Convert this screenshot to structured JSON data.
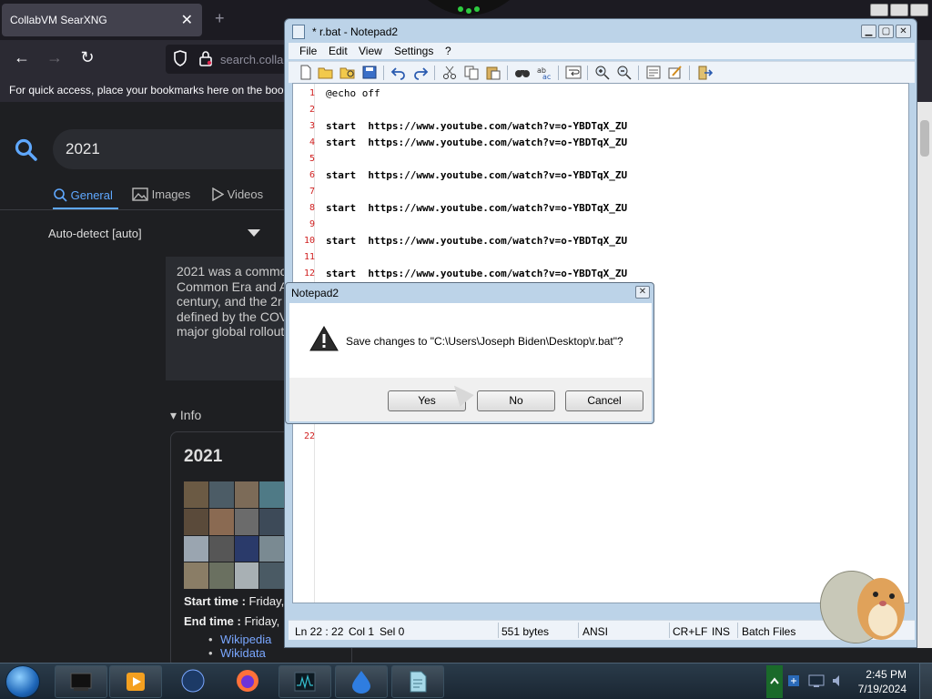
{
  "browser": {
    "tab_title": "CollabVM SearXNG",
    "tab_close": "✕",
    "new_tab": "+",
    "url_text": "search.colla",
    "bookmarks_hint": "For quick access, place your bookmarks here on the book",
    "search_query": "2021",
    "categories": [
      {
        "label": "General",
        "icon": "search-icon",
        "active": true
      },
      {
        "label": "Images",
        "icon": "image-icon",
        "active": false
      },
      {
        "label": "Videos",
        "icon": "play-icon",
        "active": false
      }
    ],
    "language_select": "Auto-detect [auto]",
    "answer_lines": [
      "2021 was a commo",
      "Common Era and A",
      "century, and the 2r",
      "defined by the COV",
      "major global rollout"
    ],
    "info_header": "▾ Info",
    "infobox": {
      "title": "2021",
      "start_label": "Start time :",
      "start_value": "Friday,",
      "end_label": "End time :",
      "end_value": "Friday,",
      "links": [
        "Wikipedia",
        "Wikidata"
      ]
    }
  },
  "notepad": {
    "title": "* r.bat - Notepad2",
    "menu": [
      "File",
      "Edit",
      "View",
      "Settings",
      "?"
    ],
    "lines": [
      {
        "num": "1",
        "text": "@echo off",
        "cmd": ""
      },
      {
        "num": "2",
        "text": "",
        "cmd": ""
      },
      {
        "num": "3",
        "cmd": "start",
        "text": "  https://www.youtube.com/watch?v=o-YBDTqX_ZU"
      },
      {
        "num": "4",
        "cmd": "start",
        "text": "  https://www.youtube.com/watch?v=o-YBDTqX_ZU"
      },
      {
        "num": "5",
        "text": "",
        "cmd": ""
      },
      {
        "num": "6",
        "cmd": "start",
        "text": "  https://www.youtube.com/watch?v=o-YBDTqX_ZU"
      },
      {
        "num": "7",
        "text": "",
        "cmd": ""
      },
      {
        "num": "8",
        "cmd": "start",
        "text": "  https://www.youtube.com/watch?v=o-YBDTqX_ZU"
      },
      {
        "num": "9",
        "text": "",
        "cmd": ""
      },
      {
        "num": "10",
        "cmd": "start",
        "text": "  https://www.youtube.com/watch?v=o-YBDTqX_ZU"
      },
      {
        "num": "11",
        "text": "",
        "cmd": ""
      },
      {
        "num": "12",
        "cmd": "start",
        "text": "  https://www.youtube.com/watch?v=o-YBDTqX_ZU"
      }
    ],
    "last_line_num": "22",
    "status": {
      "position": "Ln 22 : 22",
      "col": "Col 1",
      "sel": "Sel 0",
      "size": "551 bytes",
      "encoding": "ANSI",
      "eol": "CR+LF",
      "mode": "INS",
      "lexer": "Batch Files"
    }
  },
  "dialog": {
    "title": "Notepad2",
    "message": "Save changes to \"C:\\Users\\Joseph Biden\\Desktop\\r.bat\"?",
    "yes": "Yes",
    "no": "No",
    "cancel": "Cancel"
  },
  "taskbar": {
    "time": "2:45 PM",
    "date": "7/19/2024",
    "apps": [
      "terminal-app-icon",
      "media-player-icon",
      "globe-icon",
      "firefox-icon",
      "task-manager-icon",
      "water-drop-icon",
      "notepad-icon"
    ]
  }
}
